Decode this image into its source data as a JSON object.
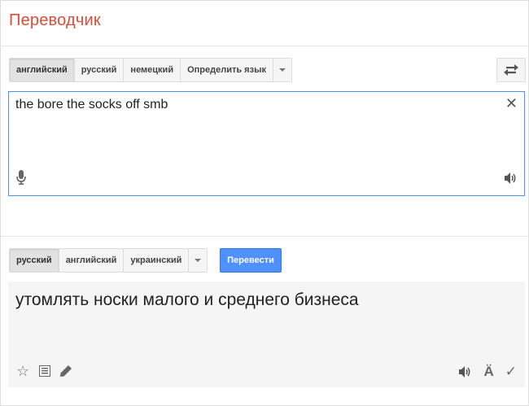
{
  "header": {
    "title": "Переводчик"
  },
  "source": {
    "tabs": [
      "английский",
      "русский",
      "немецкий",
      "Определить язык"
    ],
    "selected_index": 0,
    "text": "the bore the socks off smb"
  },
  "target": {
    "tabs": [
      "русский",
      "английский",
      "украинский"
    ],
    "selected_index": 0,
    "translate_label": "Перевести",
    "result_text": "утомлять носки малого и среднего бизнеса"
  },
  "icons": {
    "swap": "swap-languages-icon",
    "clear": "close-icon",
    "mic": "microphone-icon",
    "speaker": "speaker-icon",
    "star": "star-icon",
    "list": "list-icon",
    "pencil": "pencil-icon",
    "romanize": "romanization-icon",
    "check": "check-icon"
  },
  "colors": {
    "title": "#dd4b39",
    "focus_border": "#4d90fe",
    "translate_button": "#4d90fe",
    "result_background": "#f5f5f5"
  }
}
